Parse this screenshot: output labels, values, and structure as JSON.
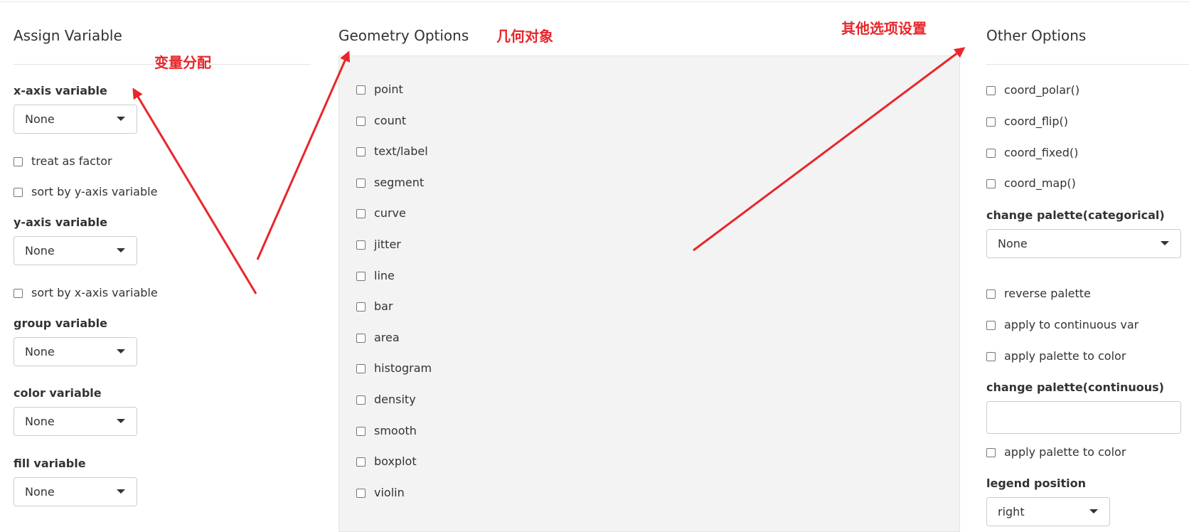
{
  "assign": {
    "title": "Assign Variable",
    "x_label": "x-axis variable",
    "x_value": "None",
    "treat_factor": "treat as factor",
    "sort_by_y": "sort by y-axis variable",
    "y_label": "y-axis variable",
    "y_value": "None",
    "sort_by_x": "sort by x-axis variable",
    "group_label": "group variable",
    "group_value": "None",
    "color_label": "color variable",
    "color_value": "None",
    "fill_label": "fill variable",
    "fill_value": "None"
  },
  "geometry": {
    "title": "Geometry Options",
    "options": [
      "point",
      "count",
      "text/label",
      "segment",
      "curve",
      "jitter",
      "line",
      "bar",
      "area",
      "histogram",
      "density",
      "smooth",
      "boxplot",
      "violin"
    ]
  },
  "other": {
    "title": "Other Options",
    "coord_options": [
      "coord_polar()",
      "coord_flip()",
      "coord_fixed()",
      "coord_map()"
    ],
    "palette_cat_label": "change palette(categorical)",
    "palette_cat_value": "None",
    "reverse_palette": "reverse palette",
    "apply_continuous": "apply to continuous var",
    "apply_color_1": "apply palette to color",
    "palette_cont_label": "change palette(continuous)",
    "palette_cont_value": "",
    "apply_color_2": "apply palette to color",
    "legend_label": "legend position",
    "legend_value": "right"
  },
  "annotations": {
    "variable_assignment": "变量分配",
    "geometry_objects": "几何对象",
    "other_settings": "其他选项设置"
  },
  "colors": {
    "annotation": "#e8262b",
    "panel_bg": "#f3f3f3",
    "border": "#cccccc"
  }
}
